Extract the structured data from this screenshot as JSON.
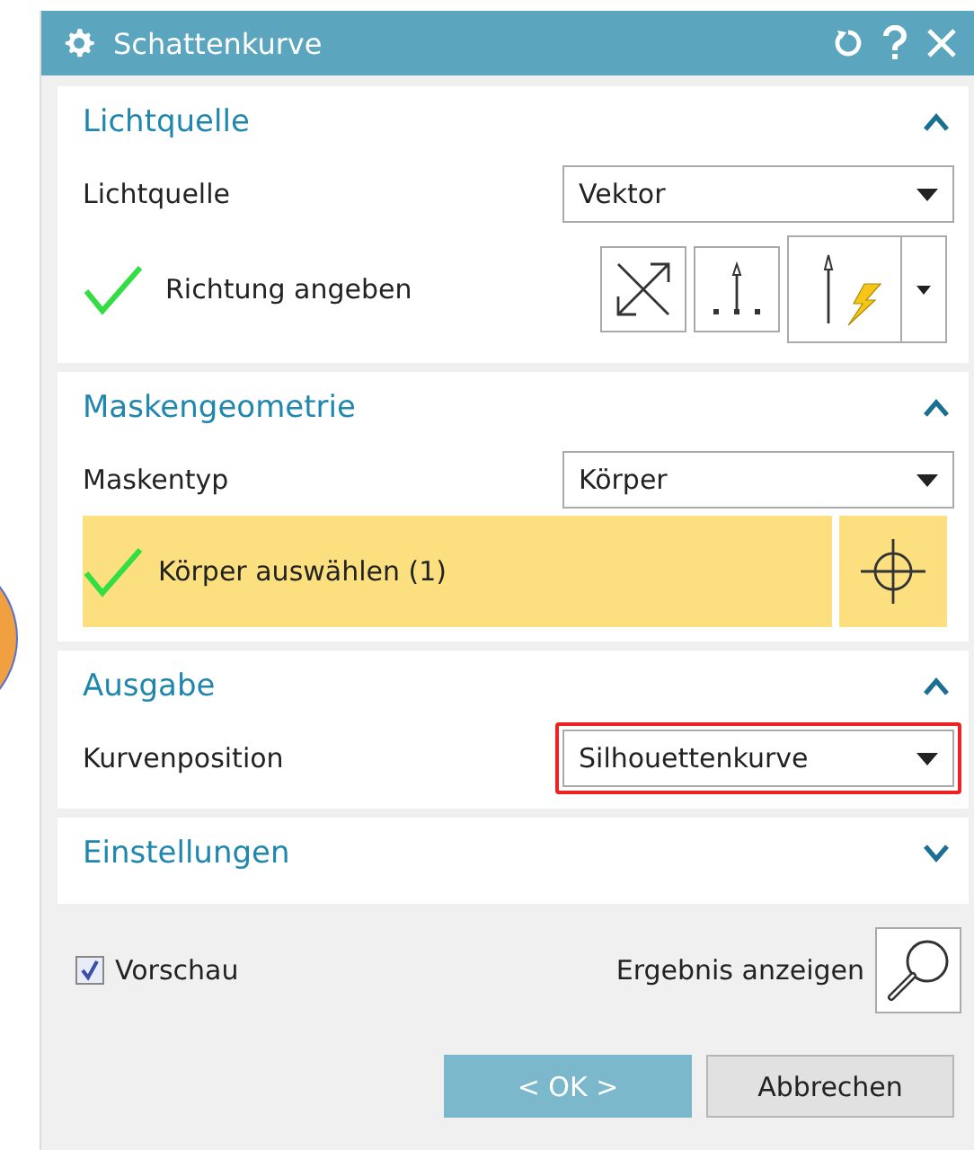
{
  "window": {
    "title": "Schattenkurve"
  },
  "sections": [
    {
      "title": "Lichtquelle",
      "expanded": true,
      "rows": [
        {
          "kind": "dropdown",
          "label": "Lichtquelle",
          "value": "Vektor",
          "highlighted": false
        },
        {
          "kind": "vector",
          "label": "Richtung angeben",
          "done": true
        }
      ]
    },
    {
      "title": "Maskengeometrie",
      "expanded": true,
      "rows": [
        {
          "kind": "dropdown",
          "label": "Maskentyp",
          "value": "Körper",
          "highlighted": false
        },
        {
          "kind": "select",
          "label": "Körper auswählen (1)",
          "done": true,
          "active": true
        }
      ]
    },
    {
      "title": "Ausgabe",
      "expanded": true,
      "rows": [
        {
          "kind": "dropdown",
          "label": "Kurvenposition",
          "value": "Silhouettenkurve",
          "highlighted": true
        }
      ]
    },
    {
      "title": "Einstellungen",
      "expanded": false
    }
  ],
  "preview": {
    "label": "Vorschau",
    "checked": true
  },
  "result": {
    "label": "Ergebnis anzeigen"
  },
  "buttons": [
    {
      "label": "< OK >",
      "kind": "primary"
    },
    {
      "label": "Abbrechen",
      "kind": "secondary"
    }
  ]
}
